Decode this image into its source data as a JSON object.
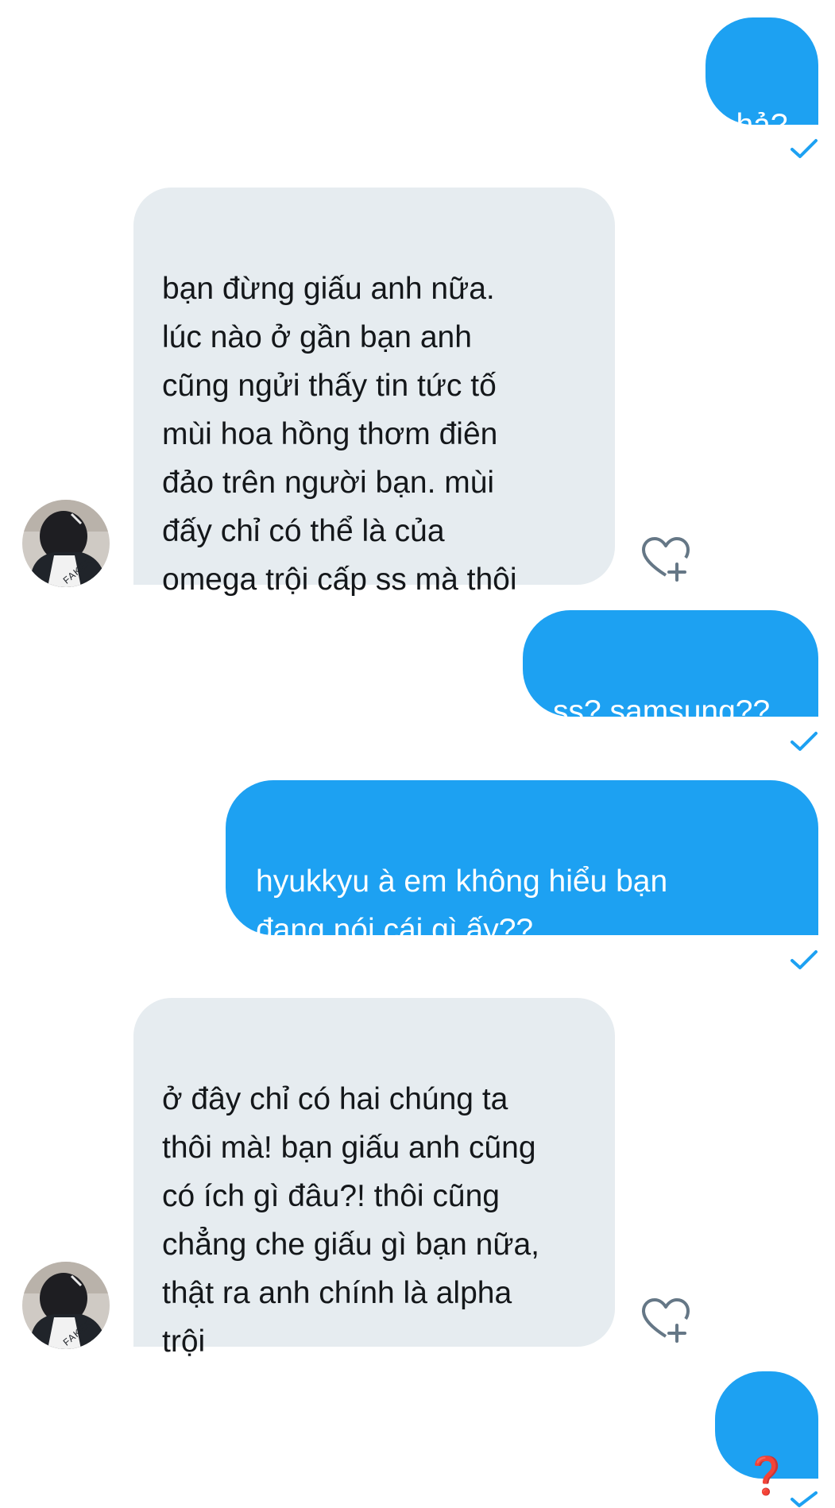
{
  "messages": [
    {
      "id": "m1",
      "direction": "sent",
      "text": "hả?",
      "read": true
    },
    {
      "id": "m2",
      "direction": "received",
      "text": "bạn đừng giấu anh nữa.\nlúc nào ở gần bạn anh\ncũng ngửi thấy tin tức tố\nmùi hoa hồng thơm điên\nđảo trên người bạn. mùi\nđấy chỉ có thể là của\nomega trội cấp ss mà thôi"
    },
    {
      "id": "m3",
      "direction": "sent",
      "text": "ss? samsung??",
      "read": true
    },
    {
      "id": "m4",
      "direction": "sent",
      "text": "hyukkyu à em không hiểu bạn\nđang nói cái gì ấy??",
      "read": true
    },
    {
      "id": "m5",
      "direction": "received",
      "text": "ở đây chỉ có hai chúng ta\nthôi mà! bạn giấu anh cũng\ncó ích gì đâu?! thôi cũng\nchẳng che giấu gì bạn nữa,\nthật ra anh chính là alpha\ntrội"
    },
    {
      "id": "m6",
      "direction": "sent",
      "text": "❓",
      "read": true
    }
  ],
  "avatar_jacket_text": "FAKER",
  "colors": {
    "sent_bubble": "#1da1f2",
    "received_bubble": "#e6ecf0",
    "read_check": "#1da1f2",
    "like_icon": "#657786"
  },
  "icons": {
    "read_receipt": "check-icon",
    "like": "heart-plus-icon"
  }
}
